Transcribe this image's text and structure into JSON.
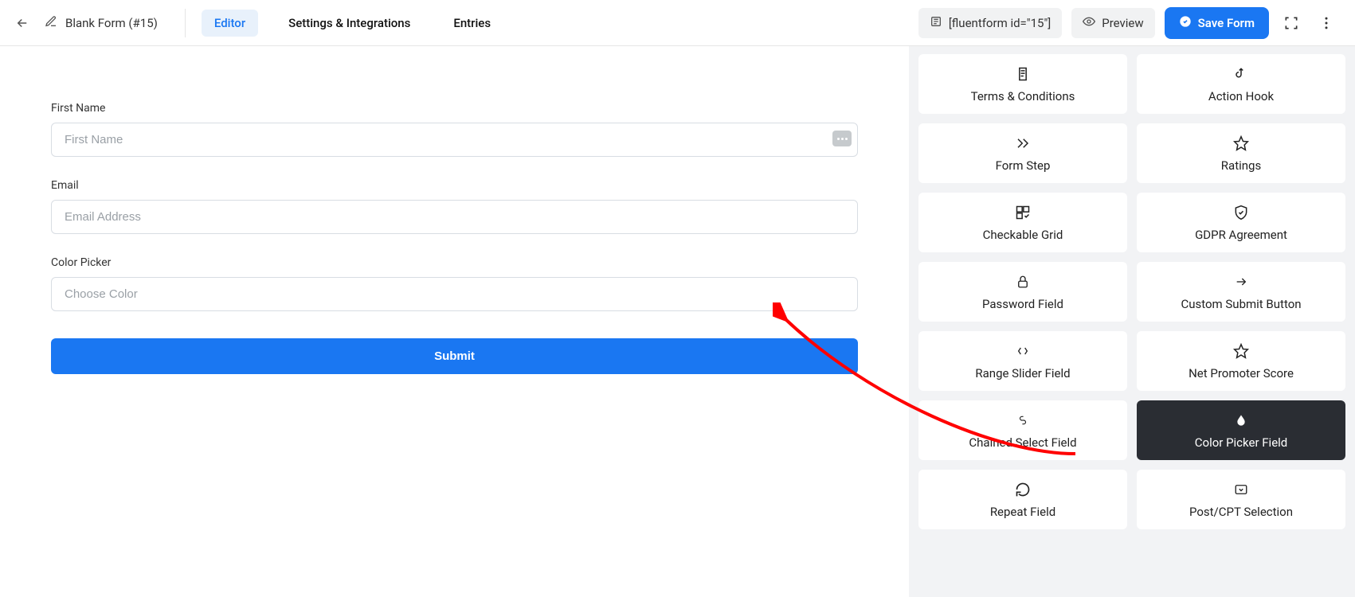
{
  "header": {
    "form_title": "Blank Form (#15)",
    "tabs": {
      "editor": "Editor",
      "settings": "Settings & Integrations",
      "entries": "Entries"
    },
    "shortcode": "[fluentform id=\"15\"]",
    "preview": "Preview",
    "save": "Save Form"
  },
  "form": {
    "fields": [
      {
        "label": "First Name",
        "placeholder": "First Name"
      },
      {
        "label": "Email",
        "placeholder": "Email Address"
      },
      {
        "label": "Color Picker",
        "placeholder": "Choose Color"
      }
    ],
    "submit_label": "Submit"
  },
  "sidebar": {
    "items": [
      {
        "name": "terms-conditions",
        "label": "Terms & Conditions",
        "icon": "scroll"
      },
      {
        "name": "action-hook",
        "label": "Action Hook",
        "icon": "hook"
      },
      {
        "name": "form-step",
        "label": "Form Step",
        "icon": "skip"
      },
      {
        "name": "ratings",
        "label": "Ratings",
        "icon": "star"
      },
      {
        "name": "checkable-grid",
        "label": "Checkable Grid",
        "icon": "grid-check"
      },
      {
        "name": "gdpr-agreement",
        "label": "GDPR Agreement",
        "icon": "shield"
      },
      {
        "name": "password-field",
        "label": "Password Field",
        "icon": "lock"
      },
      {
        "name": "custom-submit-button",
        "label": "Custom Submit Button",
        "icon": "arrow-right"
      },
      {
        "name": "range-slider",
        "label": "Range Slider Field",
        "icon": "slider"
      },
      {
        "name": "net-promoter-score",
        "label": "Net Promoter Score",
        "icon": "star"
      },
      {
        "name": "chained-select",
        "label": "Chained Select Field",
        "icon": "chain"
      },
      {
        "name": "color-picker",
        "label": "Color Picker Field",
        "icon": "drop",
        "highlight": true
      },
      {
        "name": "repeat-field",
        "label": "Repeat Field",
        "icon": "repeat"
      },
      {
        "name": "post-cpt-selection",
        "label": "Post/CPT Selection",
        "icon": "select-box"
      }
    ]
  }
}
